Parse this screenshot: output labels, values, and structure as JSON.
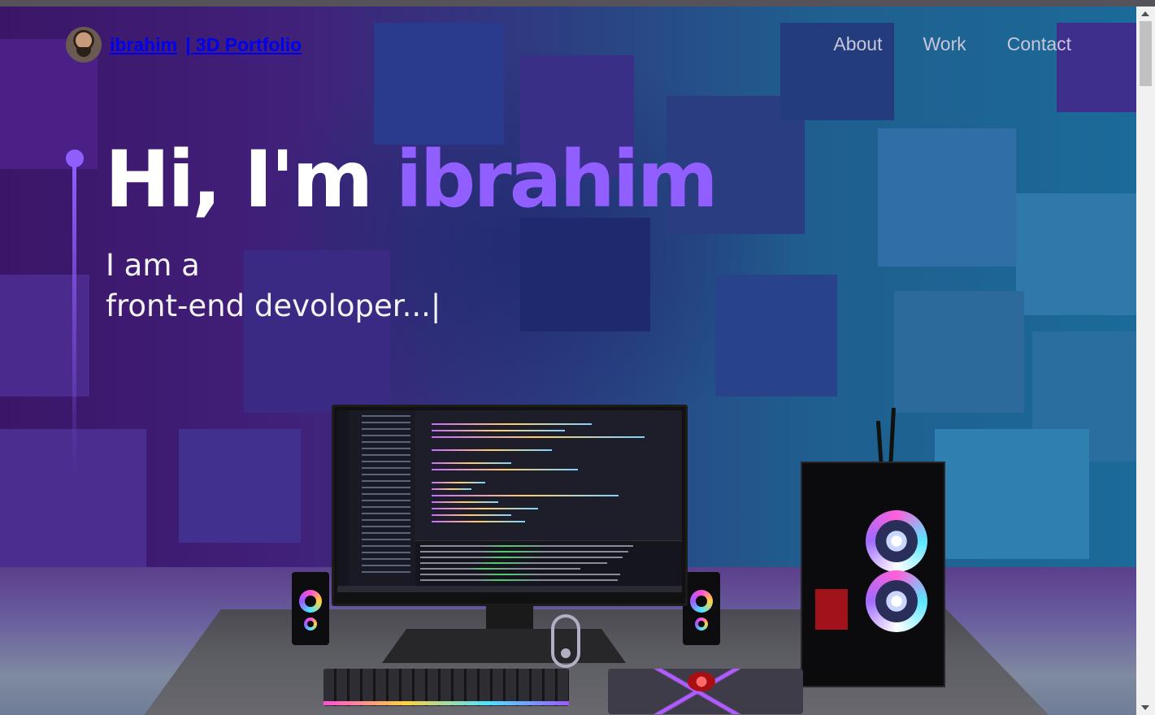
{
  "nav": {
    "name": "ibrahim",
    "subtitle": "| 3D Portfolio",
    "links": [
      "About",
      "Work",
      "Contact"
    ]
  },
  "hero": {
    "greeting": "Hi, I'm ",
    "name": "ibrahim",
    "line1": "I am a",
    "line2": "front-end devoloper...|"
  },
  "colors": {
    "accent": "#915eff",
    "text": "#ffffff",
    "nav_link": "#c8c6d8"
  },
  "icons": [
    "avatar",
    "scroll-mouse-icon",
    "chevron-up-icon",
    "chevron-down-icon"
  ]
}
